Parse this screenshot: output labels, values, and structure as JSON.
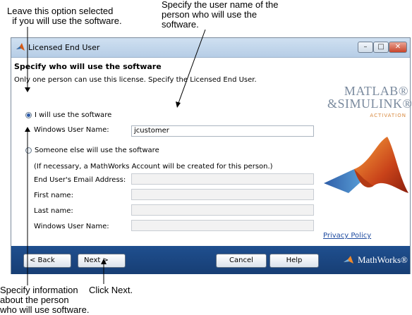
{
  "annotations": {
    "leave_selected": "Leave this option selected\n  if you will use the software.",
    "specify_user_name": "Specify the user name of the\nperson who will use the\nsoftware.",
    "specify_info": "Specify information\nabout the person\nwho will use software.",
    "click_next": "Click Next."
  },
  "window": {
    "title": "Licensed End User",
    "min_glyph": "–",
    "max_glyph": "□",
    "close_glyph": "✕"
  },
  "content": {
    "heading": "Specify who will use the software",
    "info": "Only one person can use this license. Specify the Licensed End User.",
    "option_self": {
      "label": "I will use the software",
      "selected": true
    },
    "self_username_label": "Windows User Name:",
    "self_username_value": "jcustomer",
    "option_other": {
      "label": "Someone else will use the software",
      "selected": false
    },
    "note": "(If necessary, a MathWorks Account will be created for this person.)",
    "fields": [
      {
        "label": "End User's Email Address:",
        "value": ""
      },
      {
        "label": "First name:",
        "value": ""
      },
      {
        "label": "Last name:",
        "value": ""
      },
      {
        "label": "Windows User Name:",
        "value": ""
      }
    ],
    "privacy_link": "Privacy Policy"
  },
  "logo": {
    "line1": "MATLAB®",
    "line2": "&SIMULINK®",
    "sub": "ACTIVATION"
  },
  "footer": {
    "back": "< Back",
    "next": "Next >",
    "cancel": "Cancel",
    "help": "Help",
    "brand": "MathWorks®"
  },
  "colors": {
    "footer_bg": "#1f4f8f",
    "link": "#1e4ba0",
    "logo_accent": "#d88a40"
  }
}
